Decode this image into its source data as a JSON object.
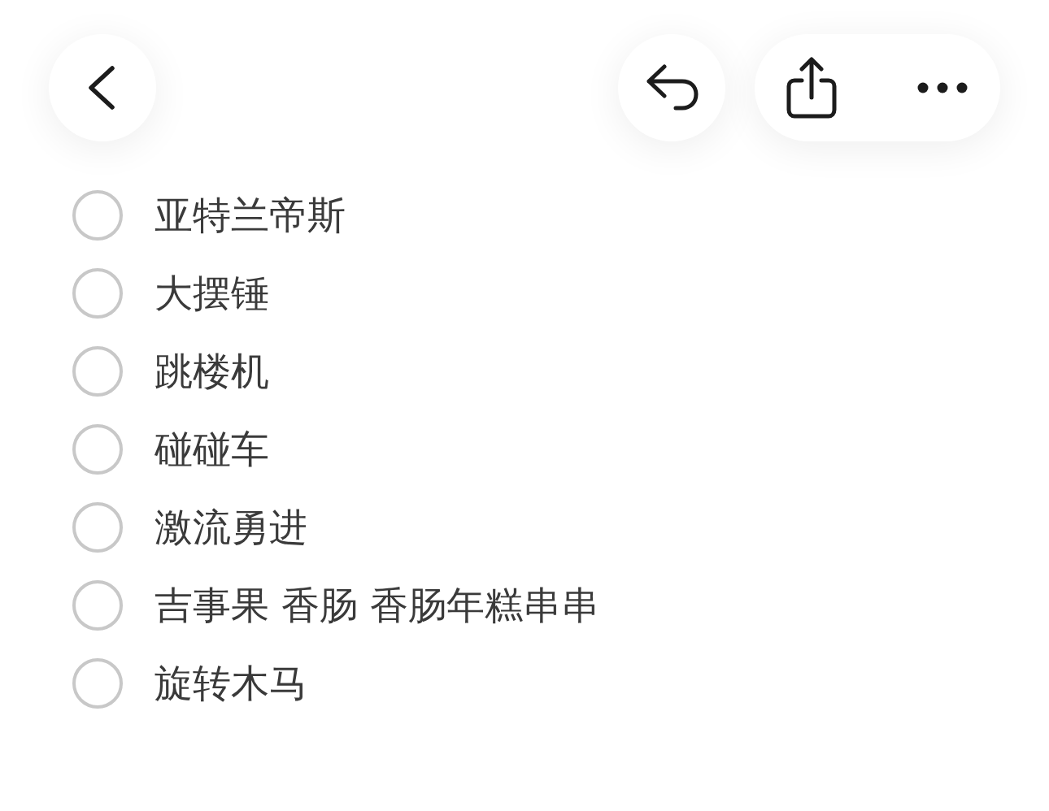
{
  "checklist": {
    "items": [
      {
        "text": "亚特兰帝斯",
        "checked": false
      },
      {
        "text": "大摆锤",
        "checked": false
      },
      {
        "text": "跳楼机",
        "checked": false
      },
      {
        "text": "碰碰车",
        "checked": false
      },
      {
        "text": "激流勇进",
        "checked": false
      },
      {
        "text": "吉事果 香肠 香肠年糕串串",
        "checked": false
      },
      {
        "text": "旋转木马",
        "checked": false
      }
    ]
  }
}
